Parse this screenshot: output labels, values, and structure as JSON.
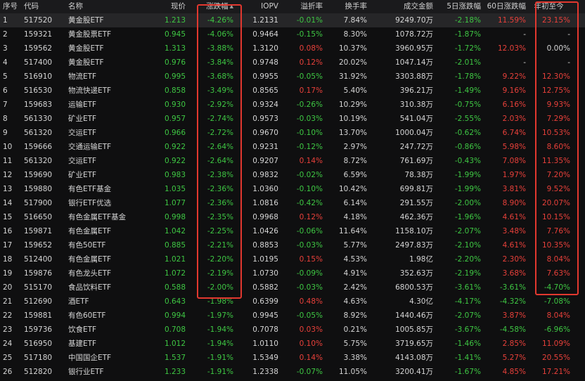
{
  "columns": {
    "idx": "序号",
    "code": "代码",
    "name": "名称",
    "price": "现价",
    "chg": "涨跌幅",
    "iopv": "IOPV",
    "prem": "溢折率",
    "turn": "换手率",
    "amt": "成交金额",
    "d5": "5日涨跌幅",
    "d60": "60日涨跌幅",
    "ytd": "年初至今"
  },
  "sort_indicator": "▲",
  "colors": {
    "up": "#e8403a",
    "down": "#3ec743",
    "neutral": "#d6d6d6",
    "highlight": "#e2382f"
  },
  "rows": [
    {
      "idx": "1",
      "code": "517520",
      "name": "黄金股ETF",
      "price": "1.213",
      "chg": "-4.26%",
      "iopv": "1.2131",
      "prem": "-0.01%",
      "turn": "7.84%",
      "amt": "9249.70万",
      "d5": "-2.18%",
      "d60": "11.59%",
      "ytd": "23.15%"
    },
    {
      "idx": "2",
      "code": "159321",
      "name": "黄金股票ETF",
      "price": "0.945",
      "chg": "-4.06%",
      "iopv": "0.9464",
      "prem": "-0.15%",
      "turn": "8.30%",
      "amt": "1078.72万",
      "d5": "-1.87%",
      "d60": "-",
      "ytd": "-"
    },
    {
      "idx": "3",
      "code": "159562",
      "name": "黄金股ETF",
      "price": "1.313",
      "chg": "-3.88%",
      "iopv": "1.3120",
      "prem": "0.08%",
      "turn": "10.37%",
      "amt": "3960.95万",
      "d5": "-1.72%",
      "d60": "12.03%",
      "ytd": "0.00%"
    },
    {
      "idx": "4",
      "code": "517400",
      "name": "黄金股ETF",
      "price": "0.976",
      "chg": "-3.84%",
      "iopv": "0.9748",
      "prem": "0.12%",
      "turn": "20.02%",
      "amt": "1047.14万",
      "d5": "-2.01%",
      "d60": "-",
      "ytd": "-"
    },
    {
      "idx": "5",
      "code": "516910",
      "name": "物流ETF",
      "price": "0.995",
      "chg": "-3.68%",
      "iopv": "0.9955",
      "prem": "-0.05%",
      "turn": "31.92%",
      "amt": "3303.88万",
      "d5": "-1.78%",
      "d60": "9.22%",
      "ytd": "12.30%"
    },
    {
      "idx": "6",
      "code": "516530",
      "name": "物流快递ETF",
      "price": "0.858",
      "chg": "-3.49%",
      "iopv": "0.8565",
      "prem": "0.17%",
      "turn": "5.40%",
      "amt": "396.21万",
      "d5": "-1.49%",
      "d60": "9.16%",
      "ytd": "12.75%"
    },
    {
      "idx": "7",
      "code": "159683",
      "name": "运输ETF",
      "price": "0.930",
      "chg": "-2.92%",
      "iopv": "0.9324",
      "prem": "-0.26%",
      "turn": "10.29%",
      "amt": "310.38万",
      "d5": "-0.75%",
      "d60": "6.16%",
      "ytd": "9.93%"
    },
    {
      "idx": "8",
      "code": "561330",
      "name": "矿业ETF",
      "price": "0.957",
      "chg": "-2.74%",
      "iopv": "0.9573",
      "prem": "-0.03%",
      "turn": "10.19%",
      "amt": "541.04万",
      "d5": "-2.55%",
      "d60": "2.03%",
      "ytd": "7.29%"
    },
    {
      "idx": "9",
      "code": "561320",
      "name": "交运ETF",
      "price": "0.966",
      "chg": "-2.72%",
      "iopv": "0.9670",
      "prem": "-0.10%",
      "turn": "13.70%",
      "amt": "1000.04万",
      "d5": "-0.62%",
      "d60": "6.74%",
      "ytd": "10.53%"
    },
    {
      "idx": "10",
      "code": "159666",
      "name": "交通运输ETF",
      "price": "0.922",
      "chg": "-2.64%",
      "iopv": "0.9231",
      "prem": "-0.12%",
      "turn": "2.97%",
      "amt": "247.72万",
      "d5": "-0.86%",
      "d60": "5.98%",
      "ytd": "8.60%"
    },
    {
      "idx": "11",
      "code": "561320",
      "name": "交运ETF",
      "price": "0.922",
      "chg": "-2.64%",
      "iopv": "0.9207",
      "prem": "0.14%",
      "turn": "8.72%",
      "amt": "761.69万",
      "d5": "-0.43%",
      "d60": "7.08%",
      "ytd": "11.35%"
    },
    {
      "idx": "12",
      "code": "159690",
      "name": "矿业ETF",
      "price": "0.983",
      "chg": "-2.38%",
      "iopv": "0.9832",
      "prem": "-0.02%",
      "turn": "6.59%",
      "amt": "78.38万",
      "d5": "-1.99%",
      "d60": "1.97%",
      "ytd": "7.20%"
    },
    {
      "idx": "13",
      "code": "159880",
      "name": "有色ETF基金",
      "price": "1.035",
      "chg": "-2.36%",
      "iopv": "1.0360",
      "prem": "-0.10%",
      "turn": "10.42%",
      "amt": "699.81万",
      "d5": "-1.99%",
      "d60": "3.81%",
      "ytd": "9.52%"
    },
    {
      "idx": "14",
      "code": "517900",
      "name": "银行ETF优选",
      "price": "1.077",
      "chg": "-2.36%",
      "iopv": "1.0816",
      "prem": "-0.42%",
      "turn": "6.14%",
      "amt": "291.55万",
      "d5": "-2.00%",
      "d60": "8.90%",
      "ytd": "20.07%"
    },
    {
      "idx": "15",
      "code": "516650",
      "name": "有色金属ETF基金",
      "price": "0.998",
      "chg": "-2.35%",
      "iopv": "0.9968",
      "prem": "0.12%",
      "turn": "4.18%",
      "amt": "462.36万",
      "d5": "-1.96%",
      "d60": "4.61%",
      "ytd": "10.15%"
    },
    {
      "idx": "16",
      "code": "159871",
      "name": "有色金属ETF",
      "price": "1.042",
      "chg": "-2.25%",
      "iopv": "1.0426",
      "prem": "-0.06%",
      "turn": "11.64%",
      "amt": "1158.10万",
      "d5": "-2.07%",
      "d60": "3.48%",
      "ytd": "7.76%"
    },
    {
      "idx": "17",
      "code": "159652",
      "name": "有色50ETF",
      "price": "0.885",
      "chg": "-2.21%",
      "iopv": "0.8853",
      "prem": "-0.03%",
      "turn": "5.77%",
      "amt": "2497.83万",
      "d5": "-2.10%",
      "d60": "4.61%",
      "ytd": "10.35%"
    },
    {
      "idx": "18",
      "code": "512400",
      "name": "有色金属ETF",
      "price": "1.021",
      "chg": "-2.20%",
      "iopv": "1.0195",
      "prem": "0.15%",
      "turn": "4.53%",
      "amt": "1.98亿",
      "d5": "-2.20%",
      "d60": "2.30%",
      "ytd": "8.04%"
    },
    {
      "idx": "19",
      "code": "159876",
      "name": "有色龙头ETF",
      "price": "1.072",
      "chg": "-2.19%",
      "iopv": "1.0730",
      "prem": "-0.09%",
      "turn": "4.91%",
      "amt": "352.63万",
      "d5": "-2.19%",
      "d60": "3.68%",
      "ytd": "7.63%"
    },
    {
      "idx": "20",
      "code": "515170",
      "name": "食品饮料ETF",
      "price": "0.588",
      "chg": "-2.00%",
      "iopv": "0.5882",
      "prem": "-0.03%",
      "turn": "2.42%",
      "amt": "6800.53万",
      "d5": "-3.61%",
      "d60": "-3.61%",
      "ytd": "-4.70%"
    },
    {
      "idx": "21",
      "code": "512690",
      "name": "酒ETF",
      "price": "0.643",
      "chg": "-1.98%",
      "iopv": "0.6399",
      "prem": "0.48%",
      "turn": "4.63%",
      "amt": "4.30亿",
      "d5": "-4.17%",
      "d60": "-4.32%",
      "ytd": "-7.08%"
    },
    {
      "idx": "22",
      "code": "159881",
      "name": "有色60ETF",
      "price": "0.994",
      "chg": "-1.97%",
      "iopv": "0.9945",
      "prem": "-0.05%",
      "turn": "8.92%",
      "amt": "1440.46万",
      "d5": "-2.07%",
      "d60": "3.87%",
      "ytd": "8.04%"
    },
    {
      "idx": "23",
      "code": "159736",
      "name": "饮食ETF",
      "price": "0.708",
      "chg": "-1.94%",
      "iopv": "0.7078",
      "prem": "0.03%",
      "turn": "0.21%",
      "amt": "1005.85万",
      "d5": "-3.67%",
      "d60": "-4.58%",
      "ytd": "-6.96%"
    },
    {
      "idx": "24",
      "code": "516950",
      "name": "基建ETF",
      "price": "1.012",
      "chg": "-1.94%",
      "iopv": "1.0110",
      "prem": "0.10%",
      "turn": "5.75%",
      "amt": "3719.65万",
      "d5": "-1.46%",
      "d60": "2.85%",
      "ytd": "11.09%"
    },
    {
      "idx": "25",
      "code": "517180",
      "name": "中国国企ETF",
      "price": "1.537",
      "chg": "-1.91%",
      "iopv": "1.5349",
      "prem": "0.14%",
      "turn": "3.38%",
      "amt": "4143.08万",
      "d5": "-1.41%",
      "d60": "5.27%",
      "ytd": "20.55%"
    },
    {
      "idx": "26",
      "code": "512820",
      "name": "银行业ETF",
      "price": "1.233",
      "chg": "-1.91%",
      "iopv": "1.2338",
      "prem": "-0.07%",
      "turn": "11.05%",
      "amt": "3200.41万",
      "d5": "-1.67%",
      "d60": "4.85%",
      "ytd": "17.21%"
    }
  ]
}
